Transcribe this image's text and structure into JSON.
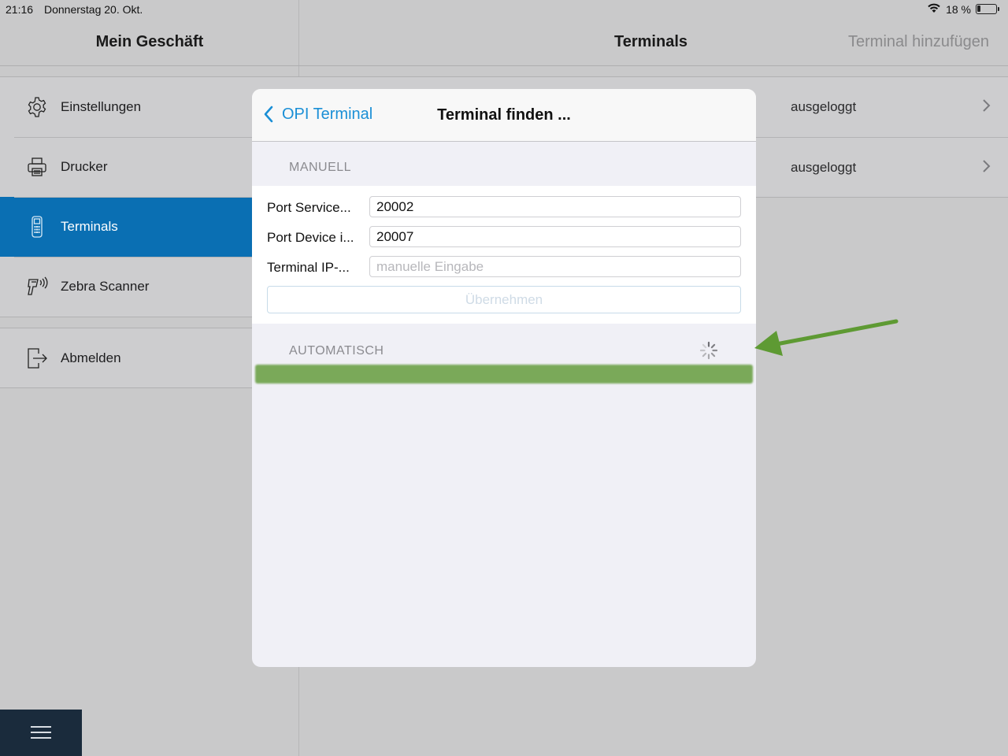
{
  "status_bar": {
    "time": "21:16",
    "date": "Donnerstag 20. Okt.",
    "battery": "18 %"
  },
  "sidebar": {
    "title": "Mein Geschäft",
    "items": [
      {
        "label": "Einstellungen",
        "icon": "gear-icon"
      },
      {
        "label": "Drucker",
        "icon": "printer-icon"
      },
      {
        "label": "Terminals",
        "icon": "card-terminal-icon",
        "active": true
      },
      {
        "label": "Zebra Scanner",
        "icon": "barcode-scanner-icon"
      }
    ],
    "logout": {
      "label": "Abmelden",
      "icon": "logout-icon"
    }
  },
  "detail": {
    "title": "Terminals",
    "add_button": "Terminal hinzufügen",
    "rows": [
      {
        "status": "ausgeloggt"
      },
      {
        "status": "ausgeloggt"
      }
    ]
  },
  "modal": {
    "back_label": "OPI Terminal",
    "title": "Terminal finden ...",
    "manual_section": "MANUELL",
    "fields": [
      {
        "label": "Port Service...",
        "value": "20002",
        "placeholder": ""
      },
      {
        "label": "Port Device i...",
        "value": "20007",
        "placeholder": ""
      },
      {
        "label": "Terminal IP-...",
        "value": "",
        "placeholder": "manuelle Eingabe"
      }
    ],
    "apply_label": "Übernehmen",
    "auto_section": "AUTOMATISCH"
  },
  "colors": {
    "accent": "#0a6fb3",
    "link": "#1a8fd6",
    "highlight": "#7aa959",
    "arrow": "#5e9a33"
  }
}
